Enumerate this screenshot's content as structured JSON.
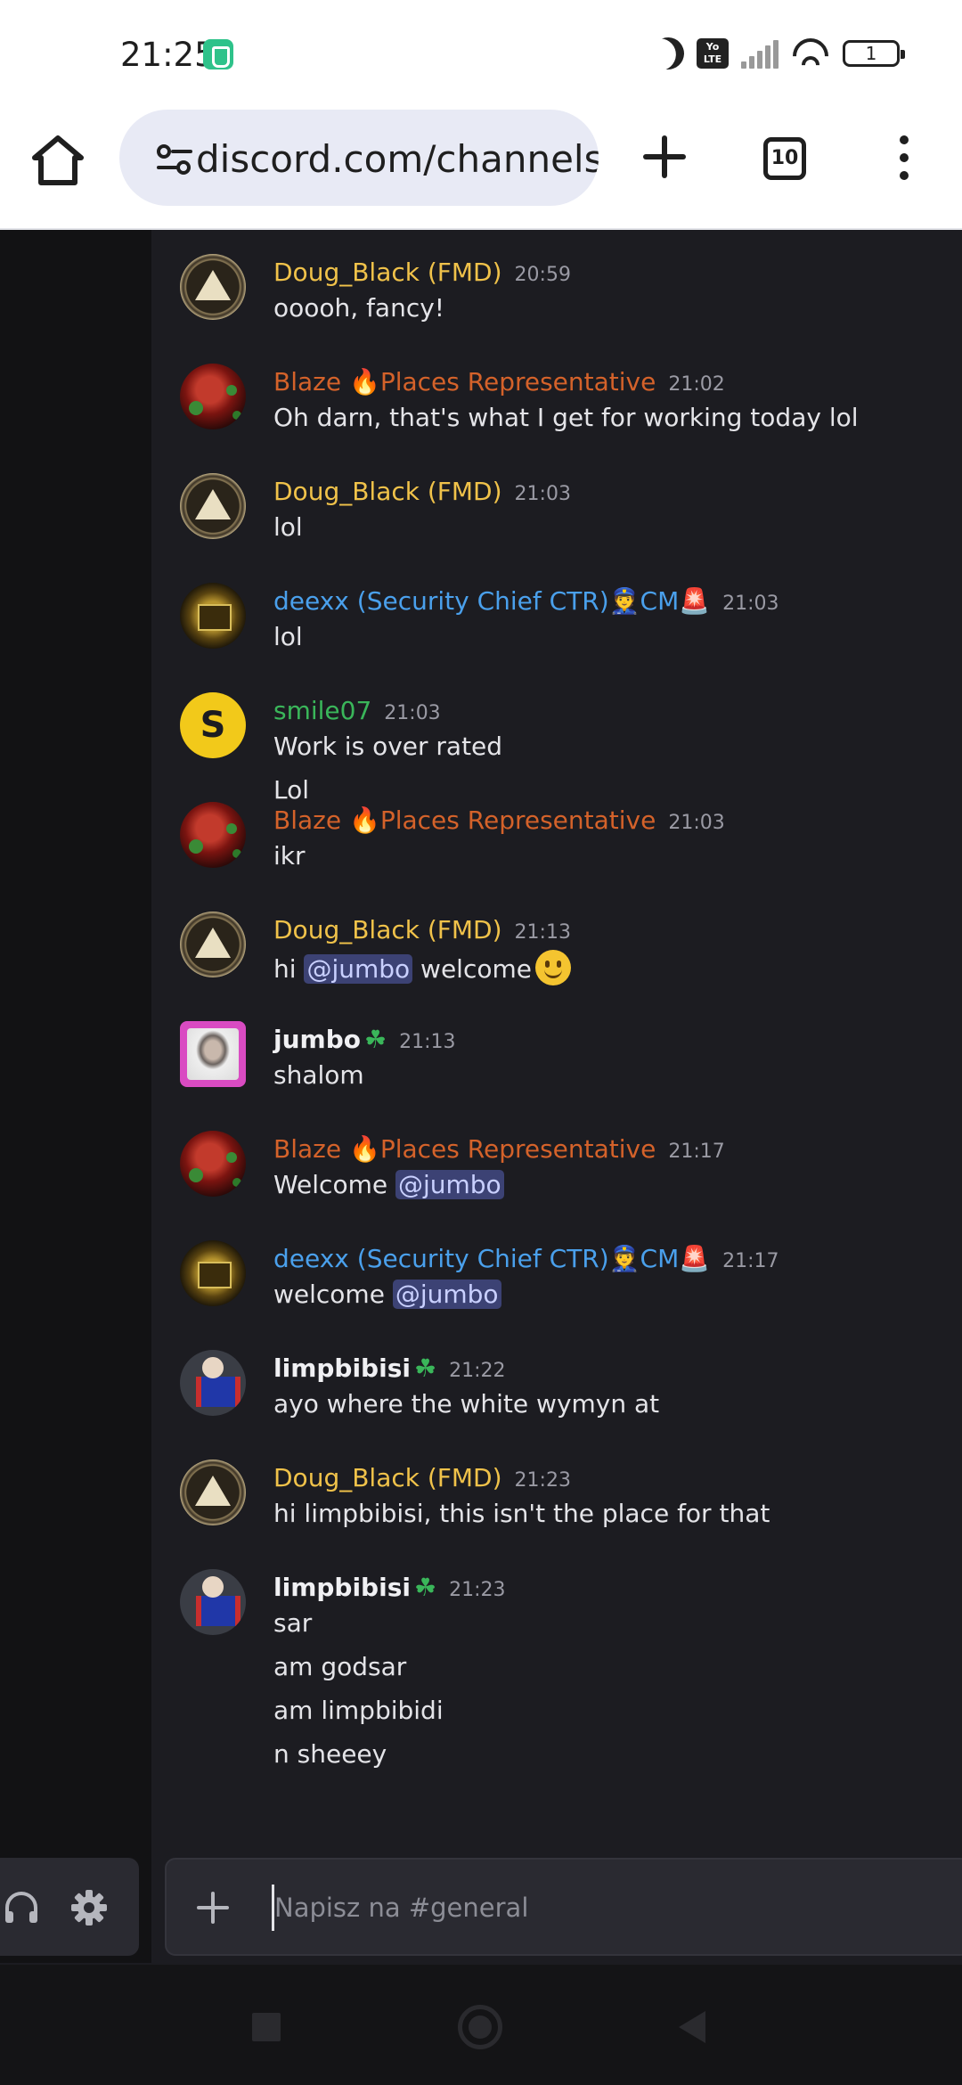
{
  "status_bar": {
    "time": "21:25",
    "battery": "1"
  },
  "browser": {
    "url": "discord.com/channels",
    "tab_count": "10"
  },
  "messages": [
    {
      "avatar": "doug",
      "author": "Doug_Black (FMD)",
      "color": "c-doug",
      "bold": false,
      "tag": "",
      "time": "20:59",
      "lines": [
        "ooooh, fancy!"
      ]
    },
    {
      "avatar": "blaze",
      "author": "Blaze 🔥Places Representative",
      "color": "c-blaze",
      "bold": false,
      "tag": "",
      "time": "21:02",
      "lines": [
        "Oh darn,  that's what I get for working today lol"
      ]
    },
    {
      "avatar": "doug",
      "author": "Doug_Black (FMD)",
      "color": "c-doug",
      "bold": false,
      "tag": "",
      "time": "21:03",
      "lines": [
        "lol"
      ]
    },
    {
      "avatar": "deexx",
      "author": "deexx (Security Chief CTR)👮CM🚨",
      "color": "c-deexx",
      "bold": false,
      "tag": "",
      "time": "21:03",
      "lines": [
        "lol"
      ]
    },
    {
      "avatar": "smile",
      "author": "smile07",
      "color": "c-smile",
      "bold": false,
      "tag": "",
      "time": "21:03",
      "lines": [
        "Work is over rated",
        "Lol"
      ],
      "avatar_letter": "S"
    },
    {
      "avatar": "blaze",
      "author": "Blaze 🔥Places Representative",
      "color": "c-blaze",
      "bold": false,
      "tag": "",
      "time": "21:03",
      "lines": [
        "ikr"
      ]
    },
    {
      "avatar": "doug",
      "author": "Doug_Black (FMD)",
      "color": "c-doug",
      "bold": false,
      "tag": "",
      "time": "21:13",
      "lines": [],
      "rich_line": {
        "before": "hi ",
        "mention": "@jumbo",
        "after": " welcome",
        "emoji": "smile"
      }
    },
    {
      "avatar": "jumbo",
      "author": "jumbo",
      "color": "c-white",
      "bold": true,
      "tag": "☘",
      "time": "21:13",
      "lines": [
        "shalom"
      ]
    },
    {
      "avatar": "blaze",
      "author": "Blaze 🔥Places Representative",
      "color": "c-blaze",
      "bold": false,
      "tag": "",
      "time": "21:17",
      "lines": [],
      "rich_line": {
        "before": "Welcome ",
        "mention": "@jumbo",
        "after": ""
      }
    },
    {
      "avatar": "deexx",
      "author": "deexx (Security Chief CTR)👮CM🚨",
      "color": "c-deexx",
      "bold": false,
      "tag": "",
      "time": "21:17",
      "lines": [],
      "rich_line": {
        "before": "welcome ",
        "mention": "@jumbo",
        "after": ""
      }
    },
    {
      "avatar": "limp",
      "author": "limpbibisi",
      "color": "c-white",
      "bold": true,
      "tag": "☘",
      "time": "21:22",
      "lines": [
        "ayo where the white wymyn at"
      ]
    },
    {
      "avatar": "doug",
      "author": "Doug_Black (FMD)",
      "color": "c-doug",
      "bold": false,
      "tag": "",
      "time": "21:23",
      "lines": [
        "hi limpbibisi, this isn't the place for that"
      ]
    },
    {
      "avatar": "limp",
      "author": "limpbibisi",
      "color": "c-white",
      "bold": true,
      "tag": "☘",
      "time": "21:23",
      "lines": [
        "sar",
        "am godsar",
        "am limpbibidi",
        "n sheeey"
      ]
    }
  ],
  "composer": {
    "placeholder": "Napisz na #general"
  }
}
